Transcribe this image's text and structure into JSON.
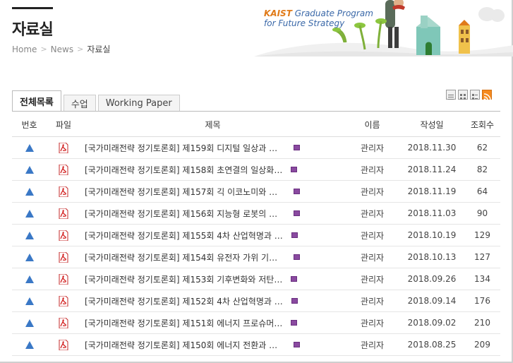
{
  "page": {
    "title": "자료실"
  },
  "breadcrumb": {
    "home": "Home",
    "section": "News",
    "current": "자료실"
  },
  "banner": {
    "brand": "KAIST",
    "line1_rest": "Graduate Program",
    "line2": "for Future Strategy"
  },
  "tabs": [
    {
      "label": "전체목록",
      "active": true
    },
    {
      "label": "수업"
    },
    {
      "label": "Working Paper"
    }
  ],
  "view_icons": [
    "list-view-icon",
    "gallery-view-icon",
    "webzine-view-icon",
    "rss-icon"
  ],
  "table": {
    "headers": {
      "no": "번호",
      "file": "파일",
      "subject": "제목",
      "author": "이름",
      "date": "작성일",
      "views": "조회수"
    },
    "rows": [
      {
        "subject": "[국가미래전략 정기토론회] 제159회 디지털 일상과 스…",
        "author": "관리자",
        "date": "2018.11.30",
        "views": "62"
      },
      {
        "subject": "[국가미래전략 정기토론회] 제158회 초연결의 일상화…",
        "author": "관리자",
        "date": "2018.11.24",
        "views": "82"
      },
      {
        "subject": "[국가미래전략 정기토론회] 제157회 긱 이코노미와 일…",
        "author": "관리자",
        "date": "2018.11.19",
        "views": "64"
      },
      {
        "subject": "[국가미래전략 정기토론회] 제156회 지능형 로봇의 미…",
        "author": "관리자",
        "date": "2018.11.03",
        "views": "90"
      },
      {
        "subject": "[국가미래전략 정기토론회] 제155회 4차 산업혁명과 …",
        "author": "관리자",
        "date": "2018.10.19",
        "views": "129"
      },
      {
        "subject": "[국가미래전략 정기토론회] 제154회 유전자 가위 기술…",
        "author": "관리자",
        "date": "2018.10.13",
        "views": "127"
      },
      {
        "subject": "[국가미래전략 정기토론회] 제153회 기후변화와 저탄…",
        "author": "관리자",
        "date": "2018.09.26",
        "views": "134"
      },
      {
        "subject": "[국가미래전략 정기토론회] 제152회 4차 산업혁명과 …",
        "author": "관리자",
        "date": "2018.09.14",
        "views": "176"
      },
      {
        "subject": "[국가미래전략 정기토론회] 제151회 에너지 프로슈머…",
        "author": "관리자",
        "date": "2018.09.02",
        "views": "210"
      },
      {
        "subject": "[국가미래전략 정기토론회] 제150회 에너지 전환과 미…",
        "author": "관리자",
        "date": "2018.08.25",
        "views": "209"
      }
    ]
  },
  "colors": {
    "notice": "#3a78c6",
    "pdf": "#d32020",
    "attach": "#8a4aa0",
    "brand_orange": "#e07b1a",
    "brand_blue": "#3a68a8"
  }
}
